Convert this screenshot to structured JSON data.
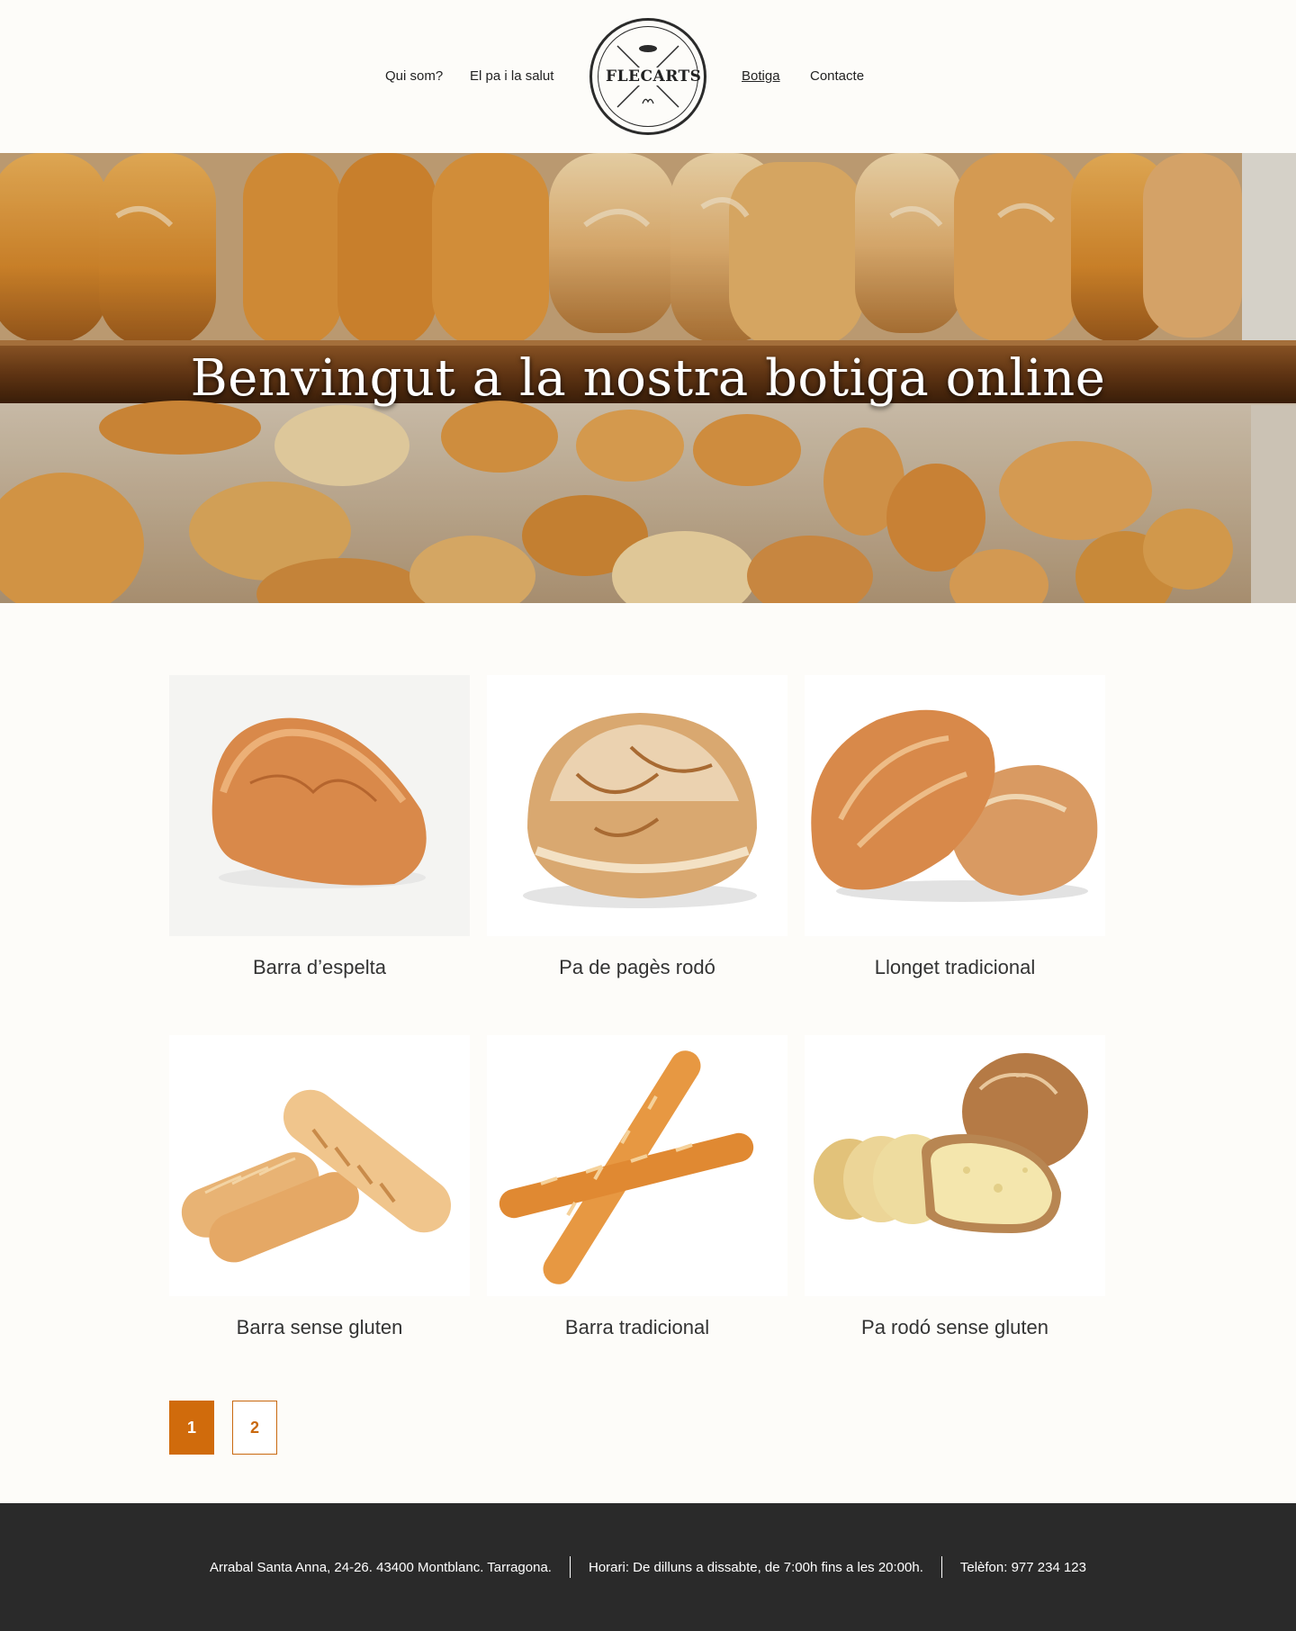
{
  "nav": {
    "left": [
      {
        "label": "Qui som?"
      },
      {
        "label": "El pa i la salut"
      }
    ],
    "right": [
      {
        "label": "Botiga",
        "active": true
      },
      {
        "label": "Contacte"
      }
    ]
  },
  "logo": {
    "text": "FLECARTS"
  },
  "hero": {
    "title": "Benvingut a la nostra botiga online"
  },
  "products": [
    {
      "name": "Barra d’espelta",
      "icon": "spelt-loaf-image"
    },
    {
      "name": "Pa de pagès rodó",
      "icon": "round-country-bread-image"
    },
    {
      "name": "Llonget tradicional",
      "icon": "llonget-rolls-image"
    },
    {
      "name": "Barra sense gluten",
      "icon": "gluten-free-bars-image"
    },
    {
      "name": "Barra tradicional",
      "icon": "baguettes-image"
    },
    {
      "name": "Pa rodó sense gluten",
      "icon": "gluten-free-round-bread-image"
    }
  ],
  "pagination": {
    "pages": [
      "1",
      "2"
    ],
    "current": "1"
  },
  "footer": {
    "address": "Arrabal Santa Anna, 24-26. 43400 Montblanc. Tarragona.",
    "hours": "Horari: De dilluns a dissabte, de 7:00h fins a les 20:00h.",
    "phone": "Telèfon: 977 234 123"
  },
  "colors": {
    "accent": "#d06b0c",
    "background": "#fdfcf9",
    "footer": "#2a2a2a"
  }
}
